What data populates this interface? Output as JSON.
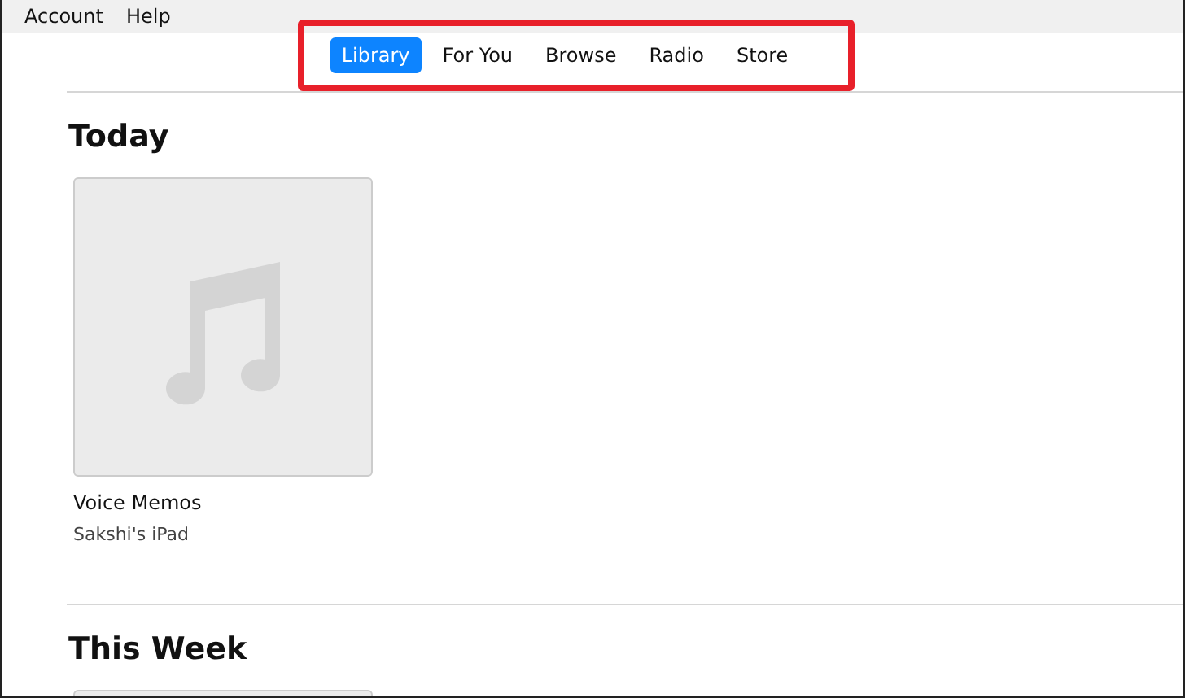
{
  "menu": [
    "Account",
    "Help"
  ],
  "nav": {
    "highlighted": true,
    "tabs": [
      {
        "label": "Library",
        "selected": true
      },
      {
        "label": "For You",
        "selected": false
      },
      {
        "label": "Browse",
        "selected": false
      },
      {
        "label": "Radio",
        "selected": false
      },
      {
        "label": "Store",
        "selected": false
      }
    ]
  },
  "sections": [
    {
      "title": "Today",
      "items": [
        {
          "title": "Voice Memos",
          "subtitle": "Sakshi's iPad"
        }
      ]
    },
    {
      "title": "This Week"
    }
  ]
}
